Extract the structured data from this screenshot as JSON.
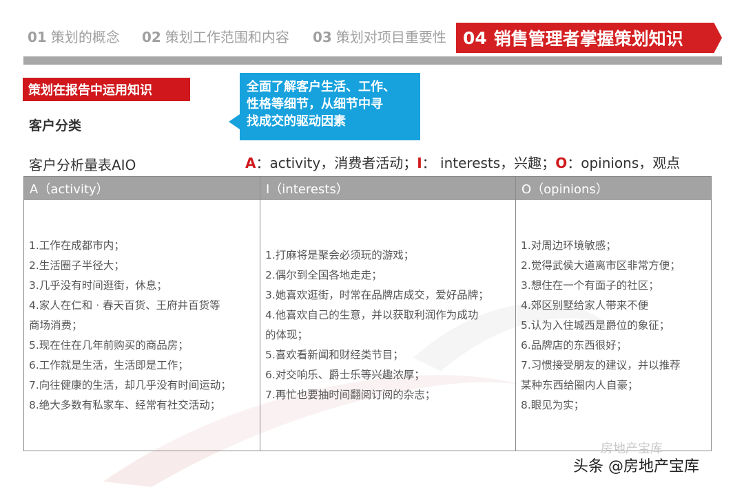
{
  "colors": {
    "accent_red": "#d41f22",
    "callout_blue": "#17a2de",
    "header_gray": "#a3a3a3"
  },
  "nav": {
    "tabs": [
      {
        "num": "01",
        "label": "策划的概念"
      },
      {
        "num": "02",
        "label": "策划工作范围和内容"
      },
      {
        "num": "03",
        "label": "策划对项目重要性"
      }
    ],
    "active": {
      "num": "04",
      "label": "销售管理者掌握策划知识"
    }
  },
  "section_label": "策划在报告中运用知识",
  "subhead": "客户分类",
  "callout": {
    "line1": "全面了解客户生活、工作、",
    "line2": "性格等细节，从细节中寻",
    "line3": "找成交的驱动因素"
  },
  "aio_label": "客户分析量表AIO",
  "legend": {
    "a_key": "A",
    "a_text": "：activity，消费者活动；",
    "i_key": "I",
    "i_text": "：  interests，兴趣；",
    "o_key": "O",
    "o_text": "：opinions，观点"
  },
  "table": {
    "headers": [
      "A（activity）",
      "I（interests）",
      "O（opinions）"
    ],
    "columns": [
      [
        "1.工作在成都市内；",
        "2.生活圈子半径大；",
        "3.几乎没有时间逛街，休息；",
        "4.家人在仁和 · 春天百货、王府井百货等",
        "商场消费；",
        "5.现在住在几年前购买的商品房；",
        "6.工作就是生活，生活即是工作；",
        "7.向往健康的生活，却几乎没有时间运动；",
        "8.绝大多数有私家车、经常有社交活动；"
      ],
      [
        "1.打麻将是聚会必须玩的游戏；",
        "2.偶尔到全国各地走走；",
        "3.她喜欢逛街，时常在品牌店成交，爱好品牌；",
        "4.他喜欢自己的生意，并以获取利润作为成功",
        "的体现；",
        "5.喜欢看新闻和财经类节目；",
        "6.对交响乐、爵士乐等兴趣浓厚；",
        "7.再忙也要抽时间翻阅订阅的杂志；"
      ],
      [
        "1.对周边环境敏感；",
        "2.觉得武侯大道离市区非常方便；",
        "3.想住在一个有面子的社区；",
        "4.郊区别墅给家人带来不便",
        "5.认为入住城西是爵位的象征；",
        "6.品牌店的东西很好；",
        "7.习惯接受朋友的建议，并以推荐",
        "某种东西给圈内人自豪；",
        "8.眼见为实；"
      ]
    ]
  },
  "watermark": {
    "faint": "房地产宝库",
    "main": "头条 @房地产宝库"
  }
}
